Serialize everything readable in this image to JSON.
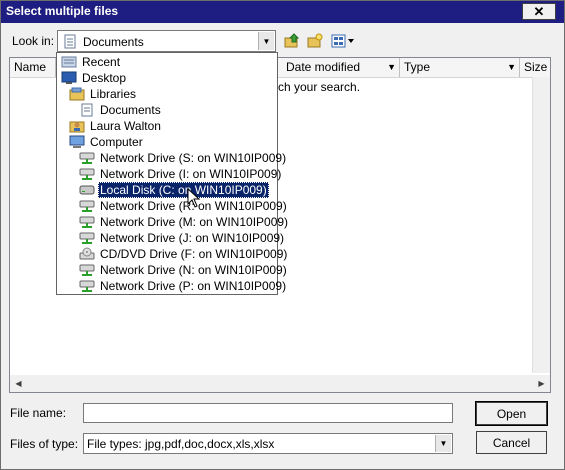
{
  "window": {
    "title": "Select multiple files",
    "close_label": "✕"
  },
  "lookin": {
    "label": "Look in:",
    "value": "Documents"
  },
  "toolbar": {
    "icons": [
      "up-folder-icon",
      "new-folder-icon",
      "view-menu-icon"
    ]
  },
  "columns": [
    {
      "label": "Name"
    },
    {
      "label": "Date modified"
    },
    {
      "label": "Type"
    },
    {
      "label": "Size"
    }
  ],
  "list": {
    "empty_message": "ch your search."
  },
  "dropdown": {
    "items": [
      {
        "label": "Recent",
        "icon": "recent-icon"
      },
      {
        "label": "Desktop",
        "icon": "desktop-icon"
      },
      {
        "label": "Libraries",
        "icon": "libraries-icon"
      },
      {
        "label": "Documents",
        "icon": "documents-icon"
      },
      {
        "label": "Laura Walton",
        "icon": "user-folder-icon"
      },
      {
        "label": "Computer",
        "icon": "computer-icon"
      },
      {
        "label": "Network Drive (S: on WIN10IP009)",
        "icon": "network-drive-icon"
      },
      {
        "label": "Network Drive (I: on WIN10IP009)",
        "icon": "network-drive-icon"
      },
      {
        "label": "Local Disk (C: on WIN10IP009)",
        "icon": "local-disk-icon",
        "selected": true
      },
      {
        "label": "Network Drive (R: on WIN10IP009)",
        "icon": "network-drive-icon"
      },
      {
        "label": "Network Drive (M: on WIN10IP009)",
        "icon": "network-drive-icon"
      },
      {
        "label": "Network Drive (J: on WIN10IP009)",
        "icon": "network-drive-icon"
      },
      {
        "label": "CD/DVD Drive (F: on WIN10IP009)",
        "icon": "cd-drive-icon"
      },
      {
        "label": "Network Drive (N: on WIN10IP009)",
        "icon": "network-drive-icon"
      },
      {
        "label": "Network Drive (P: on WIN10IP009)",
        "icon": "network-drive-icon"
      }
    ]
  },
  "filename": {
    "label": "File name:",
    "value": ""
  },
  "filetype": {
    "label": "Files of type:",
    "value": "File types: jpg,pdf,doc,docx,xls,xlsx"
  },
  "buttons": {
    "open": "Open",
    "cancel": "Cancel"
  }
}
